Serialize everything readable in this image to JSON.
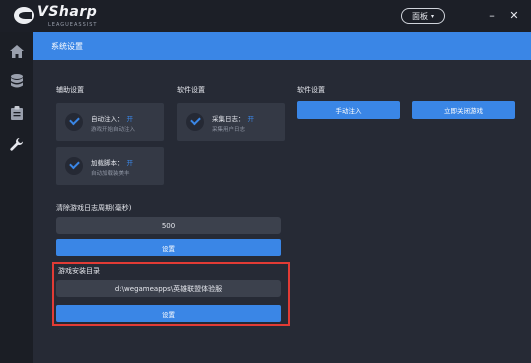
{
  "app": {
    "logo_text": "VSharp",
    "logo_sub": "LEAGUEASSIST",
    "panel_button": "面板",
    "minimize": "–",
    "close": "✕"
  },
  "sidebar": {
    "icons": [
      "home-icon",
      "database-icon",
      "clipboard-icon",
      "wrench-icon"
    ]
  },
  "banner": {
    "title": "系统设置"
  },
  "sections": {
    "assist": "辅助设置",
    "software": "软件设置",
    "software2": "软件设置",
    "clear_log": "清除游戏日志周期(毫秒)",
    "game_dir": "游戏安装目录"
  },
  "cards": [
    {
      "name": "自动注入：",
      "state": "开",
      "desc": "游戏开始自动注入"
    },
    {
      "name": "采集日志：",
      "state": "开",
      "desc": "采集用户日志"
    },
    {
      "name": "加载脚本：",
      "state": "开",
      "desc": "自动加载装美丰"
    }
  ],
  "buttons": {
    "manual_inject": "手动注入",
    "close_game": "立即关闭游戏",
    "set_log": "设置",
    "set_dir": "设置"
  },
  "fields": {
    "log_period": "500",
    "game_path": "d:\\wegameapps\\英雄联盟体验服"
  },
  "colors": {
    "accent": "#3a86e6",
    "highlight": "#e23b35",
    "background": "#262a35"
  }
}
